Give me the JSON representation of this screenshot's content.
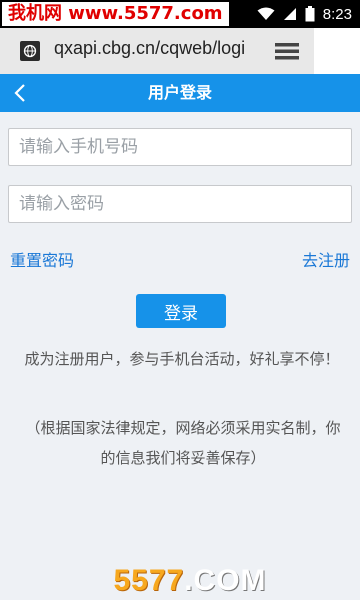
{
  "status_bar": {
    "watermark": "我机网 www.5577.com",
    "time": "8:23",
    "icons": [
      "wifi-icon",
      "signal-icon",
      "battery-icon"
    ]
  },
  "browser": {
    "url": "qxapi.cbg.cn/cqweb/logi"
  },
  "header": {
    "title": "用户登录"
  },
  "form": {
    "phone_placeholder": "请输入手机号码",
    "password_placeholder": "请输入密码",
    "reset_label": "重置密码",
    "register_label": "去注册",
    "login_label": "登录"
  },
  "promo": "成为注册用户，参与手机台活动，好礼享不停！",
  "notice": "（根据国家法律规定，网络必须采用实名制，你的信息我们将妥善保存）",
  "bottom_watermark": {
    "number": "5577",
    "suffix": ".COM"
  },
  "colors": {
    "accent": "#1692e9",
    "link": "#1a78d6",
    "background": "#eef1f5"
  }
}
